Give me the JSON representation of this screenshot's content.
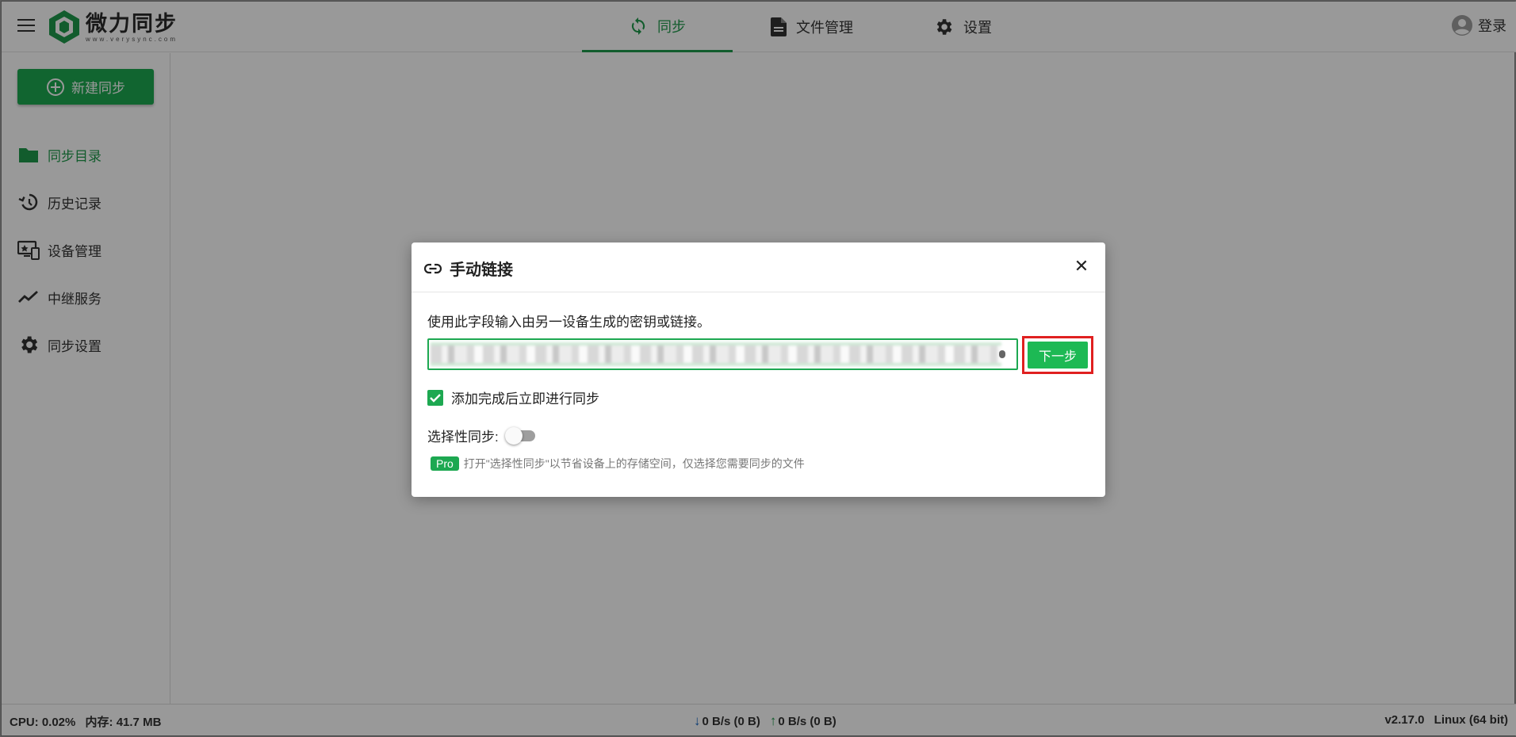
{
  "colors": {
    "accent": "#1da851",
    "highlight_border": "#e02020",
    "overlay": "rgba(0,0,0,0.4)"
  },
  "header": {
    "logo_title": "微力同步",
    "logo_subtitle": "www.verysync.com",
    "tabs": [
      {
        "label": "同步",
        "icon": "sync-icon",
        "active": true
      },
      {
        "label": "文件管理",
        "icon": "file-icon",
        "active": false
      },
      {
        "label": "设置",
        "icon": "gear-icon",
        "active": false
      }
    ],
    "login_label": "登录"
  },
  "sidebar": {
    "new_sync_label": "新建同步",
    "items": [
      {
        "label": "同步目录",
        "icon": "folder-icon",
        "active": true
      },
      {
        "label": "历史记录",
        "icon": "history-icon",
        "active": false
      },
      {
        "label": "设备管理",
        "icon": "devices-icon",
        "active": false
      },
      {
        "label": "中继服务",
        "icon": "chart-line-icon",
        "active": false
      },
      {
        "label": "同步设置",
        "icon": "gear-icon",
        "active": false
      }
    ]
  },
  "footer": {
    "cpu": "CPU: 0.02%",
    "memory": "内存: 41.7 MB",
    "download": "0 B/s (0 B)",
    "upload": "0 B/s (0 B)",
    "version": "v2.17.0",
    "os": "Linux (64 bit)"
  },
  "modal": {
    "title": "手动链接",
    "hint": "使用此字段输入由另一设备生成的密钥或链接。",
    "next_label": "下一步",
    "auto_sync_label": "添加完成后立即进行同步",
    "auto_sync_checked": true,
    "selective_sync_label": "选择性同步:",
    "selective_sync_enabled": false,
    "pro_badge": "Pro",
    "pro_hint": "打开\"选择性同步\"以节省设备上的存储空间，仅选择您需要同步的文件"
  }
}
